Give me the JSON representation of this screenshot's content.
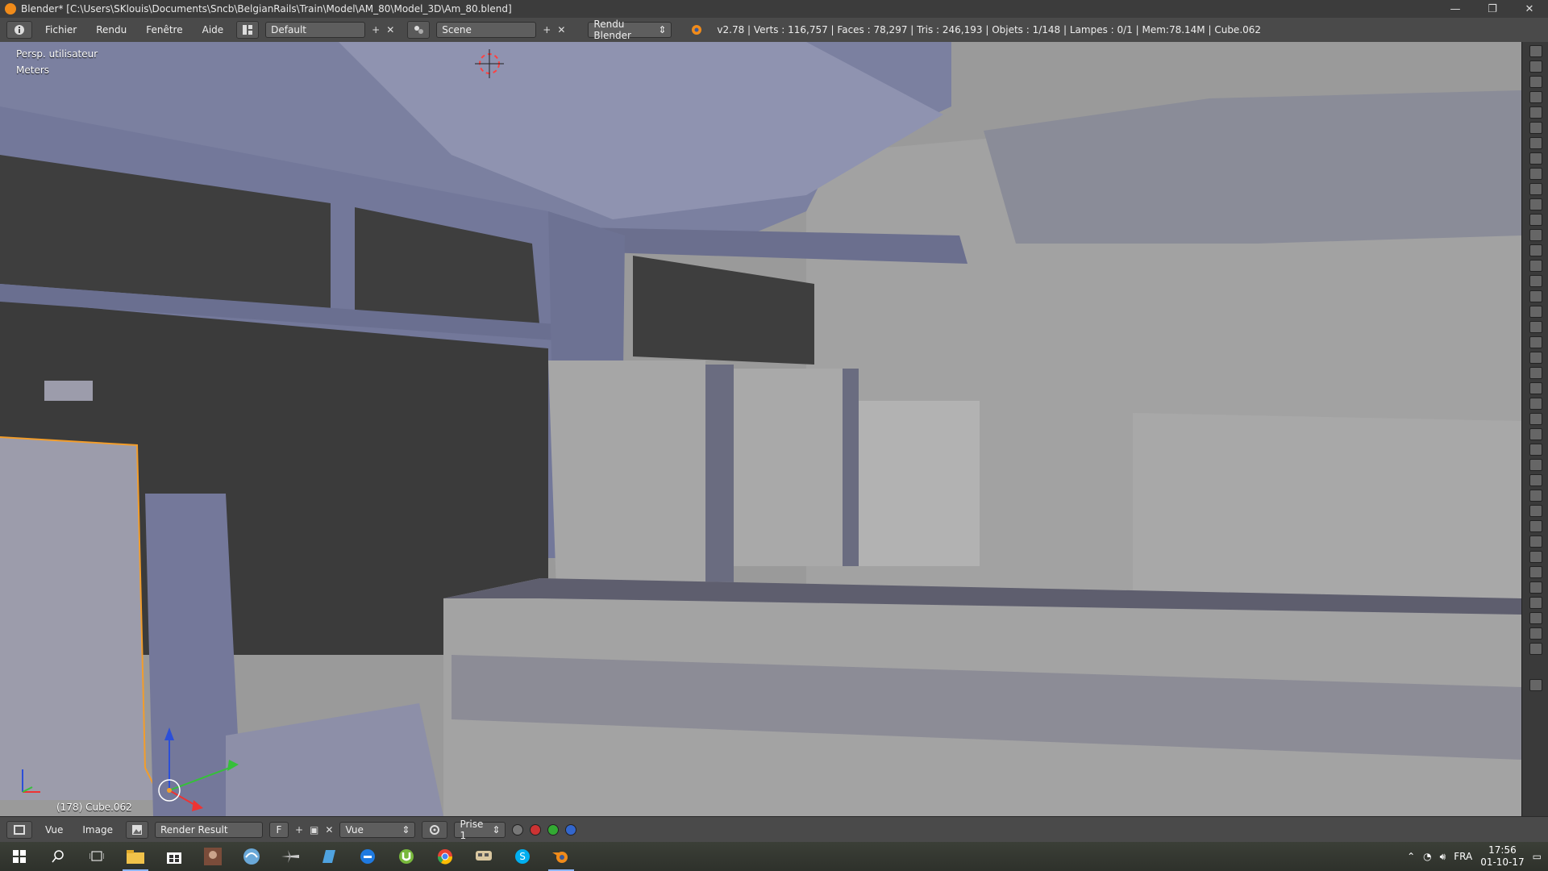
{
  "titlebar": {
    "title": "Blender* [C:\\Users\\SKlouis\\Documents\\Sncb\\BelgianRails\\Train\\Model\\AM_80\\Model_3D\\Am_80.blend]",
    "controls": [
      "—",
      "❐",
      "✕"
    ]
  },
  "infobar": {
    "menus": [
      "Fichier",
      "Rendu",
      "Fenêtre",
      "Aide"
    ],
    "layout": "Default",
    "scene": "Scene",
    "renderer": "Rendu Blender",
    "stats": "v2.78 | Verts : 116,757 | Faces : 78,297 | Tris : 246,193 | Objets : 1/148 | Lampes : 0/1 | Mem:78.14M | Cube.062"
  },
  "viewport": {
    "view_label": "Persp. utilisateur",
    "units_label": "Meters",
    "object_label": "(178) Cube.062"
  },
  "bottombar": {
    "menus": [
      "Vue",
      "Image"
    ],
    "image_name": "Render Result",
    "fake_user": "F",
    "view_mode": "Vue",
    "slot": "Prise 1"
  },
  "taskbar": {
    "apps": [
      "start-icon",
      "search-icon",
      "task-view-icon",
      "file-explorer-icon",
      "store-icon",
      "photo-app-icon",
      "wing-app-icon",
      "plane-app-icon",
      "notepad-app-icon",
      "edge-icon",
      "utorrent-icon",
      "chrome-icon",
      "train-sim-icon",
      "skype-icon",
      "blender-icon"
    ],
    "language": "FRA",
    "time": "17:56",
    "date": "01-10-17"
  },
  "colors": {
    "accent_blender": "#f08b1a",
    "viewport_bg": "#7a7f99",
    "selection_outline": "#f29d2b"
  }
}
